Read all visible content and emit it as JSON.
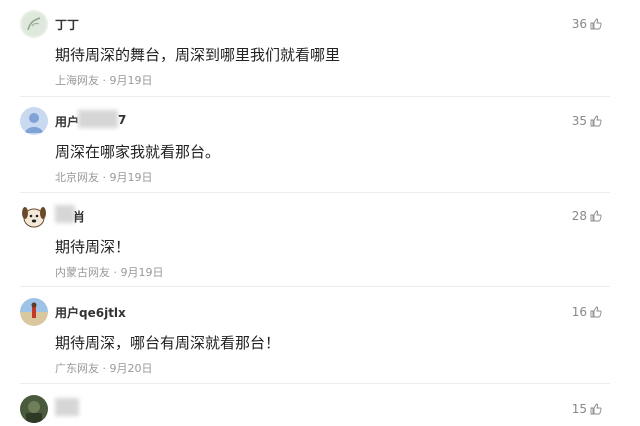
{
  "comments": [
    {
      "username": "丁丁",
      "content": "期待周深的舞台，周深到哪里我们就看哪里",
      "location": "上海网友",
      "date": "9月19日",
      "likes": "36",
      "avatar_icon": "plant-avatar-icon"
    },
    {
      "username": "用户",
      "username_tail": "7",
      "content": "周深在哪家我就看那台。",
      "location": "北京网友",
      "date": "9月19日",
      "likes": "35",
      "avatar_icon": "default-person-avatar-icon"
    },
    {
      "username": "",
      "username_tail": "肖",
      "content": "期待周深！",
      "location": "内蒙古网友",
      "date": "9月19日",
      "likes": "28",
      "avatar_icon": "cartoon-dog-avatar-icon"
    },
    {
      "username": "用户qe6jtlx",
      "content": "期待周深，哪台有周深就看那台！",
      "location": "广东网友",
      "date": "9月20日",
      "likes": "16",
      "avatar_icon": "beach-photo-avatar-icon"
    },
    {
      "username": "",
      "content": "",
      "location": "",
      "date": "",
      "likes": "15",
      "avatar_icon": "photo-avatar-icon"
    }
  ],
  "meta_separator": "·",
  "colors": {
    "text": "#222222",
    "meta": "#999999",
    "likes": "#888888",
    "divider": "#ececec"
  }
}
